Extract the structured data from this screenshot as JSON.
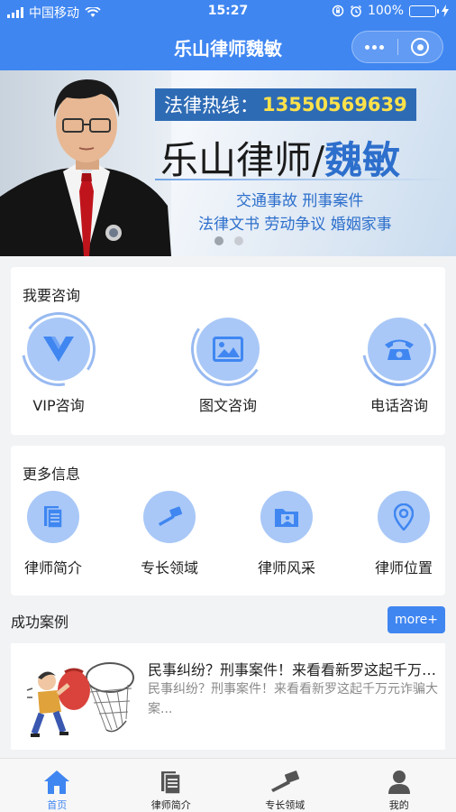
{
  "status_bar": {
    "carrier": "中国移动",
    "time": "15:27",
    "battery": "100%"
  },
  "nav": {
    "title": "乐山律师魏敏"
  },
  "banner": {
    "hotline_label": "法律热线：",
    "hotline_number": "13550569639",
    "name_prefix": "乐山律师/",
    "name_highlight": "魏敏",
    "tags_line1": "交通事故  刑事案件",
    "tags_line2": "法律文书  劳动争议  婚姻家事",
    "slide_count": 2,
    "active_slide": 1
  },
  "consult": {
    "title": "我要咨询",
    "items": [
      {
        "label": "VIP咨询",
        "icon": "vip-icon"
      },
      {
        "label": "图文咨询",
        "icon": "image-icon"
      },
      {
        "label": "电话咨询",
        "icon": "phone-icon"
      }
    ]
  },
  "info": {
    "title": "更多信息",
    "items": [
      {
        "label": "律师简介",
        "icon": "document-icon"
      },
      {
        "label": "专长领域",
        "icon": "gavel-icon"
      },
      {
        "label": "律师风采",
        "icon": "photo-folder-icon"
      },
      {
        "label": "律师位置",
        "icon": "location-pin-icon"
      }
    ]
  },
  "cases": {
    "title": "成功案例",
    "more_label": "more+",
    "items": [
      {
        "title": "民事纠纷？刑事案件！来看看新罗这起千万元诈骗大案",
        "desc": "民事纠纷？刑事案件！来看看新罗这起千万元诈骗大案..."
      }
    ]
  },
  "tabbar": {
    "items": [
      {
        "label": "首页",
        "icon": "home-icon",
        "active": true
      },
      {
        "label": "律师简介",
        "icon": "document-icon",
        "active": false
      },
      {
        "label": "专长领域",
        "icon": "gavel-icon",
        "active": false
      },
      {
        "label": "我的",
        "icon": "user-icon",
        "active": false
      }
    ]
  },
  "colors": {
    "primary": "#3f86f1",
    "icon_bg": "#a9c8f7",
    "icon_fg": "#3f86f1"
  }
}
